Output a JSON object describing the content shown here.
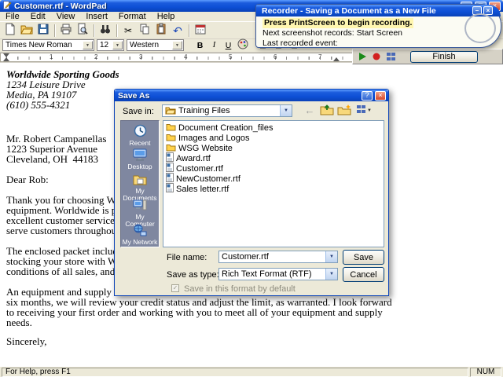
{
  "icons": {
    "cut": "✂",
    "undo": "↶",
    "caret": "▼",
    "back_arrow": "←",
    "check": "✓",
    "minimize": "–",
    "maximize": "□",
    "close": "×",
    "help": "?"
  },
  "wordpad": {
    "title": "Customer.rtf - WordPad",
    "menu": [
      "File",
      "Edit",
      "View",
      "Insert",
      "Format",
      "Help"
    ],
    "formatbar": {
      "font": "Times New Roman",
      "size": "12",
      "script": "Western",
      "bold": "B",
      "italic": "I",
      "underline": "U"
    },
    "ruler": {
      "numbers": [
        "1",
        "2",
        "3",
        "4",
        "5",
        "6",
        "7"
      ]
    },
    "document": {
      "letterhead": [
        "Worldwide Sporting Goods",
        "1234 Leisure Drive",
        "Media, PA 19107",
        "(610) 555-4321"
      ],
      "recipient": [
        "Mr. Robert Campanellas",
        "1223 Superior Avenue",
        "Cleveland, OH  44183"
      ],
      "salutation": "Dear Rob:",
      "para1": [
        "Thank you for choosing Worldwide",
        "equipment. Worldwide is proud of",
        "excellent customer service.  We hav",
        "serve customers throughout the Uni"
      ],
      "para2": [
        "The enclosed packet includes Wor",
        "stocking your store with Worldwide",
        "conditions of all sales, and our adve"
      ],
      "para3": [
        "An equipment and supply order for",
        "six months, we will review your credit status and adjust the limit, as warranted. I look forward",
        "to receiving your first order and working with you to meet all of your equipment and supply",
        "needs."
      ],
      "closing": "Sincerely,"
    },
    "statusbar": {
      "help": "For Help, press F1",
      "num": "NUM"
    }
  },
  "recorder": {
    "title": "Recorder - Saving a Document as a New File",
    "line1": "Press PrintScreen to begin recording.",
    "line2": "Next screenshot records: Start Screen",
    "line3": "Last recorded event:",
    "finish_label": "Finish"
  },
  "save_dialog": {
    "title": "Save As",
    "save_in_label": "Save in:",
    "save_in_value": "Training Files",
    "places": [
      {
        "label": "Recent"
      },
      {
        "label": "Desktop"
      },
      {
        "label": "My Documents"
      },
      {
        "label": "My Computer"
      },
      {
        "label": "My Network"
      }
    ],
    "files": [
      {
        "name": "Document Creation_files",
        "type": "folder"
      },
      {
        "name": "Images and Logos",
        "type": "folder"
      },
      {
        "name": "WSG Website",
        "type": "folder"
      },
      {
        "name": "Award.rtf",
        "type": "rtf"
      },
      {
        "name": "Customer.rtf",
        "type": "rtf"
      },
      {
        "name": "NewCustomer.rtf",
        "type": "rtf"
      },
      {
        "name": "Sales letter.rtf",
        "type": "rtf"
      }
    ],
    "file_name_label": "File name:",
    "file_name_value": "Customer.rtf",
    "save_as_type_label": "Save as type:",
    "save_as_type_value": "Rich Text Format (RTF)",
    "save_label": "Save",
    "cancel_label": "Cancel",
    "default_format_label": "Save in this format by default"
  }
}
